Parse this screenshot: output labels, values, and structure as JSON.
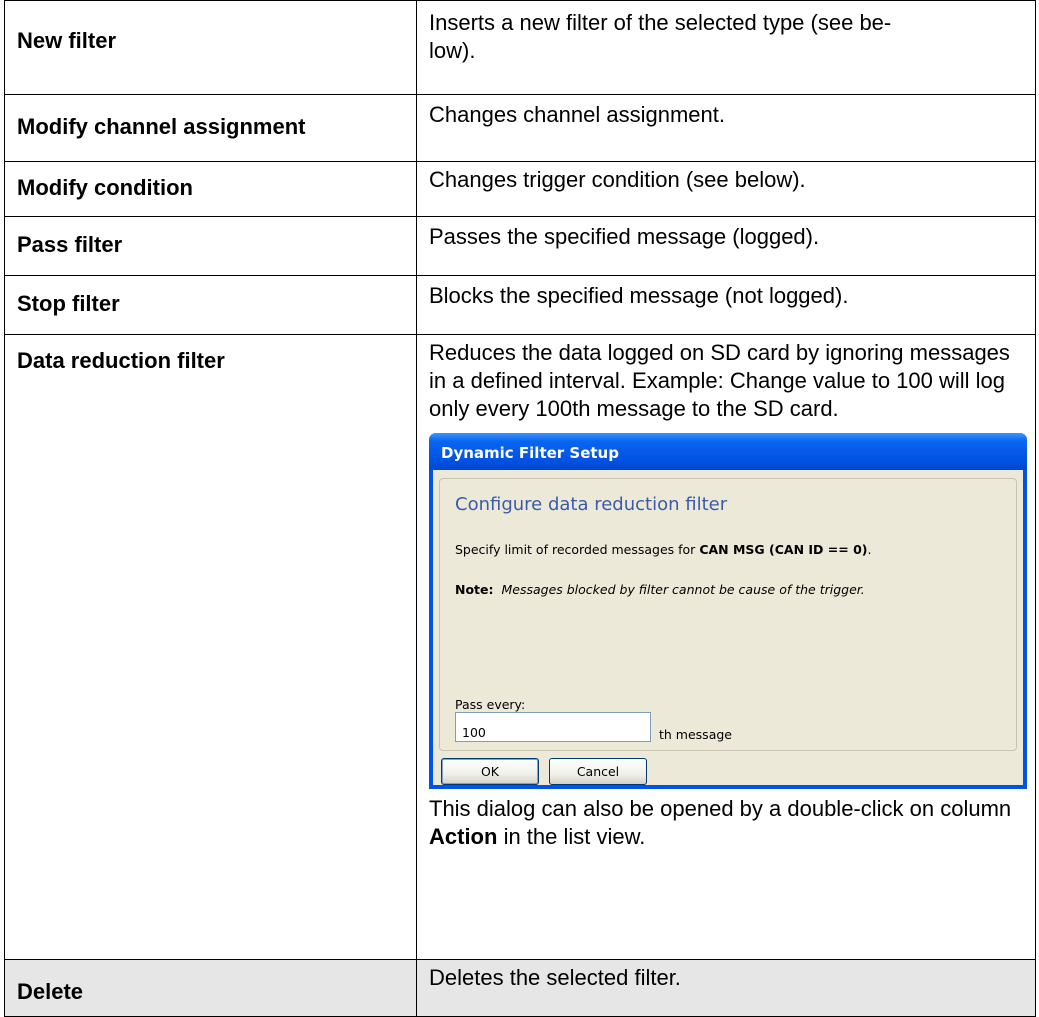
{
  "rows": [
    {
      "term": "New filter",
      "desc": "Inserts a new filter of the selected type (see be-\nlow)."
    },
    {
      "term": "Modify channel assignment",
      "desc": "Changes channel assignment."
    },
    {
      "term": "Modify condition",
      "desc": "Changes trigger condition (see below)."
    },
    {
      "term": "Pass filter",
      "desc": "Passes the specified message (logged)."
    },
    {
      "term": "Stop filter",
      "desc": "Blocks the specified message (not logged)."
    },
    {
      "term": "Data reduction filter",
      "desc": "Reduces the data logged on SD card by ignoring messages in a defined interval. Example: Change value to 100 will log only every 100th message to the SD card."
    },
    {
      "term": "Delete",
      "desc": "Deletes the selected filter."
    }
  ],
  "after_dialog": {
    "text_before": "This dialog can also be opened by a double-click on column ",
    "bold": "Action",
    "text_after": " in the list view."
  },
  "dialog": {
    "title": "Dynamic Filter Setup",
    "heading": "Configure data reduction filter",
    "message_prefix": "Specify limit of recorded messages for ",
    "message_bold": "CAN MSG (CAN ID == 0)",
    "message_suffix": ".",
    "note_label": "Note:",
    "note_text": "Messages blocked by filter cannot be cause of the trigger.",
    "pass_label": "Pass every:",
    "pass_value": "100",
    "pass_suffix": "th message",
    "ok_label": "OK",
    "cancel_label": "Cancel"
  },
  "colors": {
    "shaded_cell": "#e6e6e6",
    "titlebar": "#0054e3",
    "dialog_face": "#ece9d8",
    "heading": "#3b5ba8"
  }
}
